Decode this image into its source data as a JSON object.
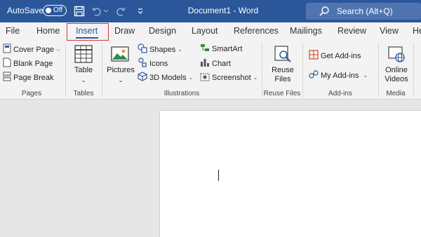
{
  "titlebar": {
    "autosave_label": "AutoSave",
    "autosave_state": "Off",
    "document_title": "Document1  -  Word",
    "search_placeholder": "Search (Alt+Q)"
  },
  "tabs": [
    {
      "label": "File"
    },
    {
      "label": "Home"
    },
    {
      "label": "Insert",
      "active": true
    },
    {
      "label": "Draw"
    },
    {
      "label": "Design"
    },
    {
      "label": "Layout"
    },
    {
      "label": "References"
    },
    {
      "label": "Mailings"
    },
    {
      "label": "Review"
    },
    {
      "label": "View"
    },
    {
      "label": "He"
    }
  ],
  "ribbon": {
    "pages": {
      "cover_page": "Cover Page",
      "blank_page": "Blank Page",
      "page_break": "Page Break",
      "group_label": "Pages"
    },
    "tables": {
      "table": "Table",
      "group_label": "Tables"
    },
    "illustrations": {
      "pictures": "Pictures",
      "shapes": "Shapes",
      "icons": "Icons",
      "models3d": "3D Models",
      "smartart": "SmartArt",
      "chart": "Chart",
      "screenshot": "Screenshot",
      "group_label": "Illustrations"
    },
    "reuse_files": {
      "line1": "Reuse",
      "line2": "Files",
      "group_label": "Reuse Files"
    },
    "addins": {
      "get_addins": "Get Add-ins",
      "my_addins": "My Add-ins",
      "group_label": "Add-ins"
    },
    "media": {
      "line1": "Online",
      "line2": "Videos",
      "group_label": "Media"
    }
  },
  "colors": {
    "titlebar": "#2b579a",
    "active_tab_outline": "#d9363e",
    "ribbon_bg": "#f3f3f3"
  }
}
